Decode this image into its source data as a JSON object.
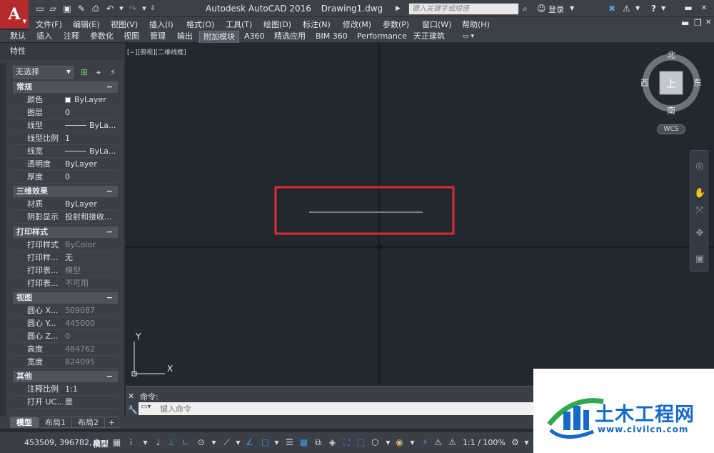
{
  "window": {
    "app_name": "Autodesk AutoCAD 2016",
    "file_name": "Drawing1.dwg",
    "search_placeholder": "键入关键字或短语",
    "login_label": "登录",
    "help_label": "?"
  },
  "menu": {
    "items": [
      "文件(F)",
      "编辑(E)",
      "视图(V)",
      "插入(I)",
      "格式(O)",
      "工具(T)",
      "绘图(D)",
      "标注(N)",
      "修改(M)",
      "参数(P)",
      "窗口(W)",
      "帮助(H)"
    ]
  },
  "ribbon_tabs": {
    "items": [
      "默认",
      "插入",
      "注释",
      "参数化",
      "视图",
      "管理",
      "输出",
      "附加模块",
      "A360",
      "精选应用",
      "BIM 360",
      "Performance",
      "天正建筑"
    ],
    "active": "附加模块"
  },
  "palette": {
    "title": "特性",
    "selection": "无选择",
    "sections": [
      {
        "title": "常规",
        "toggle": "−",
        "rows": [
          {
            "name": "颜色",
            "value": "ByLayer"
          },
          {
            "name": "图层",
            "value": "0"
          },
          {
            "name": "线型",
            "value": "ByLa..."
          },
          {
            "name": "线型比例",
            "value": "1"
          },
          {
            "name": "线宽",
            "value": "ByLa..."
          },
          {
            "name": "透明度",
            "value": "ByLayer"
          },
          {
            "name": "厚度",
            "value": "0"
          }
        ]
      },
      {
        "title": "三维效果",
        "toggle": "−",
        "rows": [
          {
            "name": "材质",
            "value": "ByLayer"
          },
          {
            "name": "阴影显示",
            "value": "投射和接收..."
          }
        ]
      },
      {
        "title": "打印样式",
        "toggle": "−",
        "rows": [
          {
            "name": "打印样式",
            "value": "ByColor"
          },
          {
            "name": "打印样...",
            "value": "无"
          },
          {
            "name": "打印表...",
            "value": "模型"
          },
          {
            "name": "打印表...",
            "value": "不可用"
          }
        ]
      },
      {
        "title": "视图",
        "toggle": "−",
        "rows": [
          {
            "name": "圆心 X...",
            "value": "509087"
          },
          {
            "name": "圆心 Y...",
            "value": "445000"
          },
          {
            "name": "圆心 Z...",
            "value": "0"
          },
          {
            "name": "高度",
            "value": "484762"
          },
          {
            "name": "宽度",
            "value": "824095"
          }
        ]
      },
      {
        "title": "其他",
        "toggle": "−",
        "rows": [
          {
            "name": "注释比例",
            "value": "1:1"
          },
          {
            "name": "打开 UC...",
            "value": "是"
          }
        ]
      }
    ]
  },
  "viewport": {
    "controls_label": "[−][俯视][二维线框]",
    "viewcube": {
      "north": "北",
      "south": "南",
      "east": "东",
      "west": "西",
      "face": "上",
      "wcs": "WCS"
    },
    "ucs": {
      "x": "X",
      "y": "Y"
    }
  },
  "command": {
    "history": "命令:",
    "placeholder": "键入命令"
  },
  "layout_tabs": {
    "items": [
      "模型",
      "布局1",
      "布局2"
    ],
    "active": "模型",
    "add": "+"
  },
  "status": {
    "coords": "453509, 396782, 0",
    "model": "模型",
    "scale": "1:1 / 100%"
  },
  "watermark": {
    "text": "土木工程网",
    "url": "www.civilcn.com"
  },
  "colors": {
    "highlight_box": "#e02a2f",
    "crosshair": "#111111",
    "drawn_line": "#d8d8d8",
    "watermark_blue": "#1569c7"
  }
}
